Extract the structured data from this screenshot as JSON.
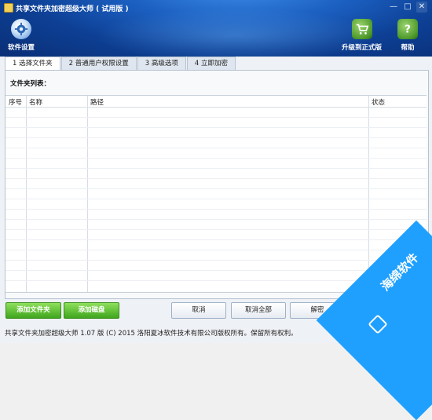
{
  "window": {
    "title": "共享文件夹加密超级大师 ( 试用版 )",
    "controls": {
      "minimize": "—",
      "maximize": "□",
      "close": "✕"
    }
  },
  "toolbar": {
    "settings_label": "软件设置",
    "upgrade_label": "升级到正式版",
    "help_label": "帮助",
    "icons": {
      "settings": "gear-icon",
      "upgrade": "cart-icon",
      "help": "question-icon"
    }
  },
  "tabs": [
    {
      "label": "1 选择文件夹",
      "active": true
    },
    {
      "label": "2 普通用户权限设置",
      "active": false
    },
    {
      "label": "3 高级选项",
      "active": false
    },
    {
      "label": "4 立即加密",
      "active": false
    }
  ],
  "folder_list": {
    "label": "文件夹列表：",
    "columns": [
      "序号",
      "名称",
      "路径",
      "状态"
    ],
    "rows": []
  },
  "buttons": {
    "add_folder": "添加文件夹",
    "add_disk": "添加磁盘",
    "cancel": "取消",
    "cancel_all": "取消全部",
    "decrypt": "解密"
  },
  "status": "共享文件夹加密超级大师 1.07 版  (C)  2015 洛阳夏冰软件技术有限公司版权所有。保留所有权利。",
  "watermark": {
    "text": "海绵软件"
  },
  "colors": {
    "header": "#1b5fc0",
    "accent_green": "#3fa51d",
    "watermark": "#1fa0ff"
  }
}
